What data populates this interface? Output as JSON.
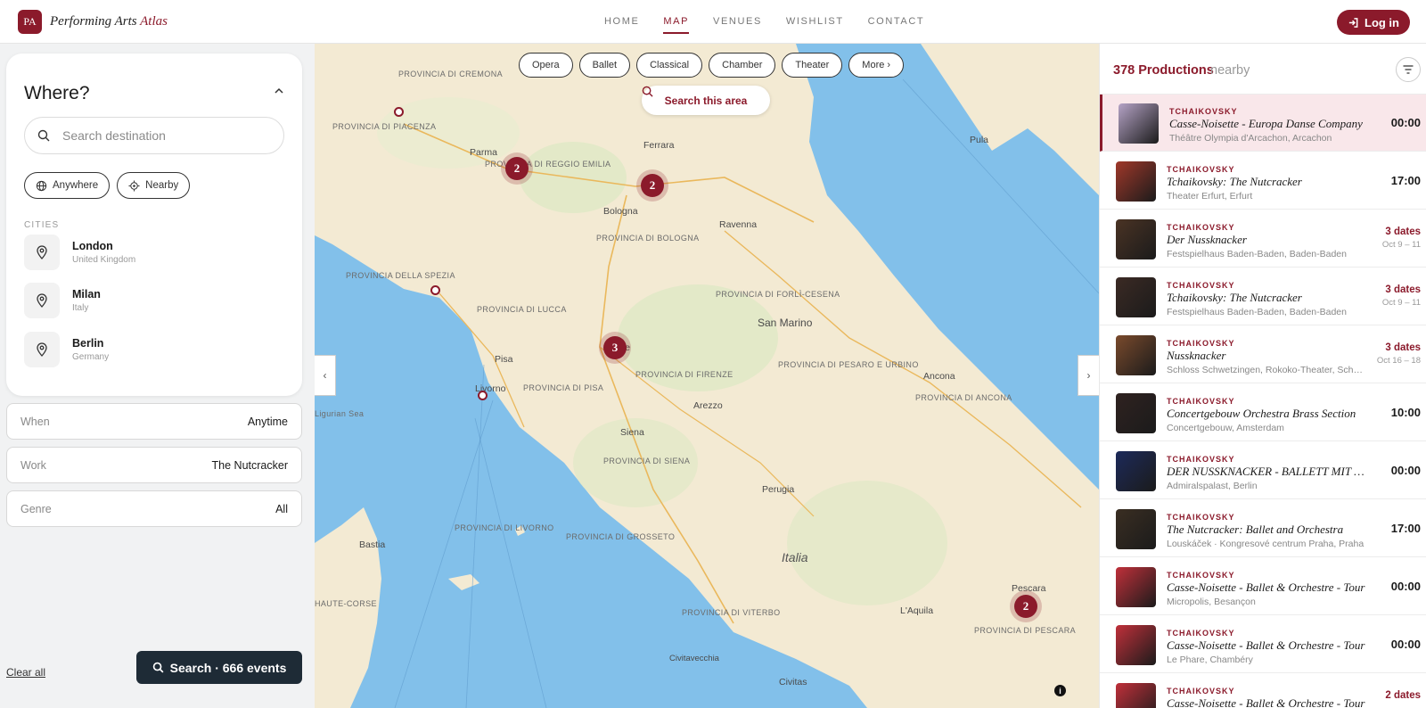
{
  "brand": {
    "badge": "PA",
    "name": "Performing Arts",
    "accent": "Atlas"
  },
  "nav": [
    {
      "label": "HOME",
      "active": false
    },
    {
      "label": "MAP",
      "active": true
    },
    {
      "label": "VENUES",
      "active": false
    },
    {
      "label": "WISHLIST",
      "active": false
    },
    {
      "label": "CONTACT",
      "active": false
    }
  ],
  "header": {
    "login_label": "Log in"
  },
  "left_panel": {
    "where_title": "Where?",
    "search_placeholder": "Search destination",
    "chips": [
      {
        "label": "Anywhere",
        "icon": "globe-icon"
      },
      {
        "label": "Nearby",
        "icon": "locate-icon"
      }
    ],
    "cities_label": "CITIES",
    "cities": [
      {
        "name": "London",
        "country": "United Kingdom"
      },
      {
        "name": "Milan",
        "country": "Italy"
      },
      {
        "name": "Berlin",
        "country": "Germany"
      }
    ],
    "filters": [
      {
        "label": "When",
        "value": "Anytime"
      },
      {
        "label": "Work",
        "value": "The Nutcracker"
      },
      {
        "label": "Genre",
        "value": "All"
      }
    ],
    "clear_label": "Clear all",
    "search_label": "Search · 666 events"
  },
  "map": {
    "genres": [
      "Opera",
      "Ballet",
      "Classical",
      "Chamber",
      "Theater",
      "More ›"
    ],
    "search_area_label": "Search this area",
    "clusters": [
      {
        "count": "2"
      },
      {
        "count": "2"
      },
      {
        "count": "3"
      },
      {
        "count": "2"
      }
    ],
    "places": [
      "Parma",
      "Ferrara",
      "Bologna",
      "Ravenna",
      "Pula",
      "San Marino",
      "Pisa",
      "Livorno",
      "Arezzo",
      "Siena",
      "Perugia",
      "Ancona",
      "Bastia",
      "Pescara",
      "L'Aquila",
      "Civitavecchia",
      "Civitas",
      "Italia",
      "ze",
      "Ligurian Sea"
    ],
    "provinces": [
      "PROVINCIA DI CREMONA",
      "PROVINCIA DI PIACENZA",
      "PROVINCIA DI REGGIO EMILIA",
      "PROVINCIA DI BOLOGNA",
      "PROVINCIA DELLA SPEZIA",
      "PROVINCIA DI LUCCA",
      "PROVINCIA DI FORLÌ-CESENA",
      "PROVINCIA DI PESARO E URBINO",
      "PROVINCIA DI ANCONA",
      "PROVINCIA DI LIVORNO",
      "PROVINCIA DI SIENA",
      "PROVINCIA DI GROSSETO",
      "PROVINCIA DI VITERBO",
      "HAUTE-CORSE",
      "PROVINCIA DI PESCARA",
      "PROVINCIA DI FIRENZE",
      "PROVINCIA DI PISA"
    ]
  },
  "right_panel": {
    "count": "378 Productions",
    "suffix": "nearby",
    "productions": [
      {
        "composer": "TCHAIKOVSKY",
        "title": "Casse-Noisette - Europa Danse Company",
        "venue": "Théâtre Olympia d'Arcachon, Arcachon",
        "time": "00:00",
        "dates": "",
        "range": "",
        "selected": true,
        "thumb": "#b5a3c6"
      },
      {
        "composer": "TCHAIKOVSKY",
        "title": "Tchaikovsky: The Nutcracker",
        "venue": "Theater Erfurt, Erfurt",
        "time": "17:00",
        "dates": "",
        "range": "",
        "selected": false,
        "thumb": "#a0382a"
      },
      {
        "composer": "TCHAIKOVSKY",
        "title": "Der Nussknacker",
        "venue": "Festspielhaus Baden-Baden, Baden-Baden",
        "time": "",
        "dates": "3 dates",
        "range": "Oct 9 – 11",
        "selected": false,
        "thumb": "#4a3324"
      },
      {
        "composer": "TCHAIKOVSKY",
        "title": "Tchaikovsky: The Nutcracker",
        "venue": "Festspielhaus Baden-Baden, Baden-Baden",
        "time": "",
        "dates": "3 dates",
        "range": "Oct 9 – 11",
        "selected": false,
        "thumb": "#3b2a24"
      },
      {
        "composer": "TCHAIKOVSKY",
        "title": "Nussknacker",
        "venue": "Schloss Schwetzingen, Rokoko-Theater, Schwetzingen",
        "time": "",
        "dates": "3 dates",
        "range": "Oct 16 – 18",
        "selected": false,
        "thumb": "#7a4a2c"
      },
      {
        "composer": "TCHAIKOVSKY",
        "title": "Concertgebouw Orchestra Brass Section",
        "venue": "Concertgebouw, Amsterdam",
        "time": "10:00",
        "dates": "",
        "range": "",
        "selected": false,
        "thumb": "#2f2220"
      },
      {
        "composer": "TCHAIKOVSKY",
        "title": "DER NUSSKNACKER - BALLETT MIT ORCHESTER",
        "venue": "Admiralspalast, Berlin",
        "time": "00:00",
        "dates": "",
        "range": "",
        "selected": false,
        "thumb": "#1c2a5a"
      },
      {
        "composer": "TCHAIKOVSKY",
        "title": "The Nutcracker: Ballet and Orchestra",
        "venue": "Louskáček · Kongresové centrum Praha, Praha",
        "time": "17:00",
        "dates": "",
        "range": "",
        "selected": false,
        "thumb": "#3a2e22"
      },
      {
        "composer": "TCHAIKOVSKY",
        "title": "Casse-Noisette - Ballet & Orchestre - Tour",
        "venue": "Micropolis, Besançon",
        "time": "00:00",
        "dates": "",
        "range": "",
        "selected": false,
        "thumb": "#c0303a"
      },
      {
        "composer": "TCHAIKOVSKY",
        "title": "Casse-Noisette - Ballet & Orchestre - Tour",
        "venue": "Le Phare, Chambéry",
        "time": "00:00",
        "dates": "",
        "range": "",
        "selected": false,
        "thumb": "#c0303a"
      },
      {
        "composer": "TCHAIKOVSKY",
        "title": "Casse-Noisette - Ballet & Orchestre - Tour",
        "venue": "",
        "time": "",
        "dates": "2 dates",
        "range": "",
        "selected": false,
        "thumb": "#c0303a"
      }
    ]
  },
  "colors": {
    "accent": "#8b1a2b",
    "land": "#f3ead3",
    "sea": "#82c0ea",
    "dark_button": "#1e2b36"
  }
}
